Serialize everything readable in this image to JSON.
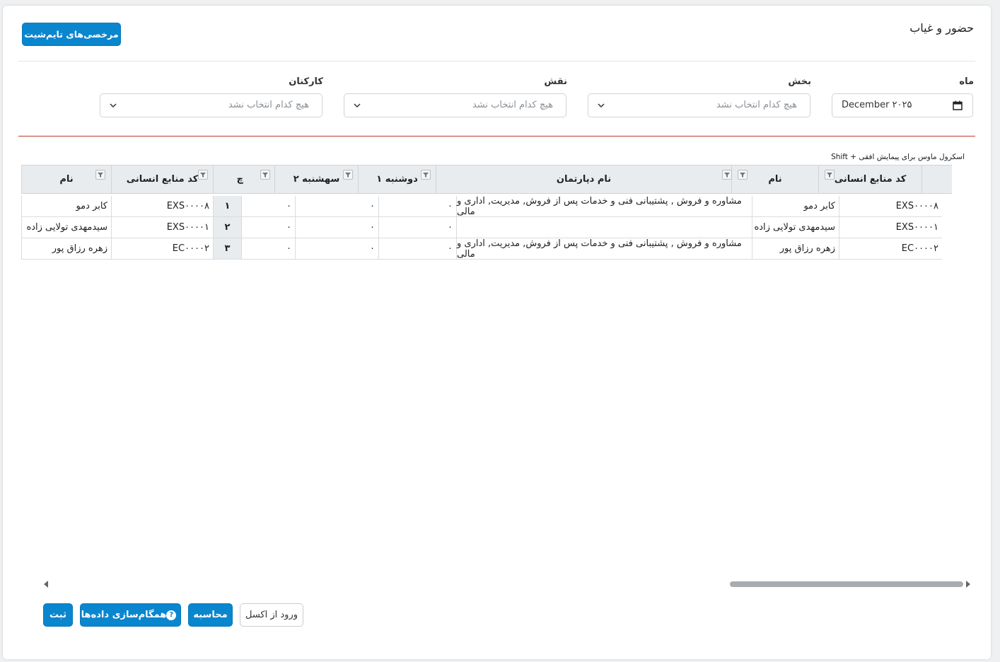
{
  "page": {
    "title": "حضور و غیاب"
  },
  "header_button": "مرخصی‌های تایم‌شیت",
  "filters": {
    "month": {
      "label": "ماه",
      "value": "December ۲۰۲۵"
    },
    "section": {
      "label": "بخش",
      "placeholder": "هیچ کدام انتخاب نشد"
    },
    "role": {
      "label": "نقش",
      "placeholder": "هیچ کدام انتخاب نشد"
    },
    "staff": {
      "label": "کارکنان",
      "placeholder": "هیچ کدام انتخاب نشد"
    }
  },
  "hint": "Shift + اسکرول ماوس برای پیمایش افقی",
  "grid": {
    "headers": {
      "hr_code": "کد منابع انسانی",
      "name": "نام",
      "department": "نام دپارتمان",
      "monday1": "دوشنبه ۱",
      "tuesday2": "سهشنبه ۲",
      "w": "چ",
      "hr_code_2": "کد منابع انسانی",
      "name_2": "نام"
    },
    "rows": [
      {
        "hr_code": "EXS۰۰۰۰۸",
        "name": "کابر دمو",
        "department": "مشاوره و فروش , پشتیبانی فنی و خدمات پس از فروش, مدیریت, اداری و مالی",
        "monday1": "۰",
        "tuesday2": "۰",
        "w": "۰",
        "index": "۱",
        "hr_code_2": "EXS۰۰۰۰۸",
        "name_2": "کابر دمو"
      },
      {
        "hr_code": "EXS۰۰۰۰۱",
        "name": "سیدمهدی تولایی زاده",
        "department": "",
        "monday1": "۰",
        "tuesday2": "۰",
        "w": "۰",
        "index": "۲",
        "hr_code_2": "EXS۰۰۰۰۱",
        "name_2": "سیدمهدی تولایی زاده"
      },
      {
        "hr_code": "EC۰۰۰۰۲",
        "name": "زهره رزاق پور",
        "department": "مشاوره و فروش , پشتیبانی فنی و خدمات پس از فروش, مدیریت, اداری و مالی",
        "monday1": "۰",
        "tuesday2": "۰",
        "w": "۰",
        "index": "۳",
        "hr_code_2": "EC۰۰۰۰۲",
        "name_2": "زهره رزاق پور"
      }
    ]
  },
  "actions": {
    "submit": "ثبت",
    "sync": "همگام‌سازی داده‌ها",
    "sync_help": "?",
    "calculate": "محاسبه",
    "excel_import": "ورود از اکسل"
  },
  "colors": {
    "primary": "#0a86cf",
    "divider_accent": "#c0392b",
    "header_bg": "#e9ecef"
  }
}
